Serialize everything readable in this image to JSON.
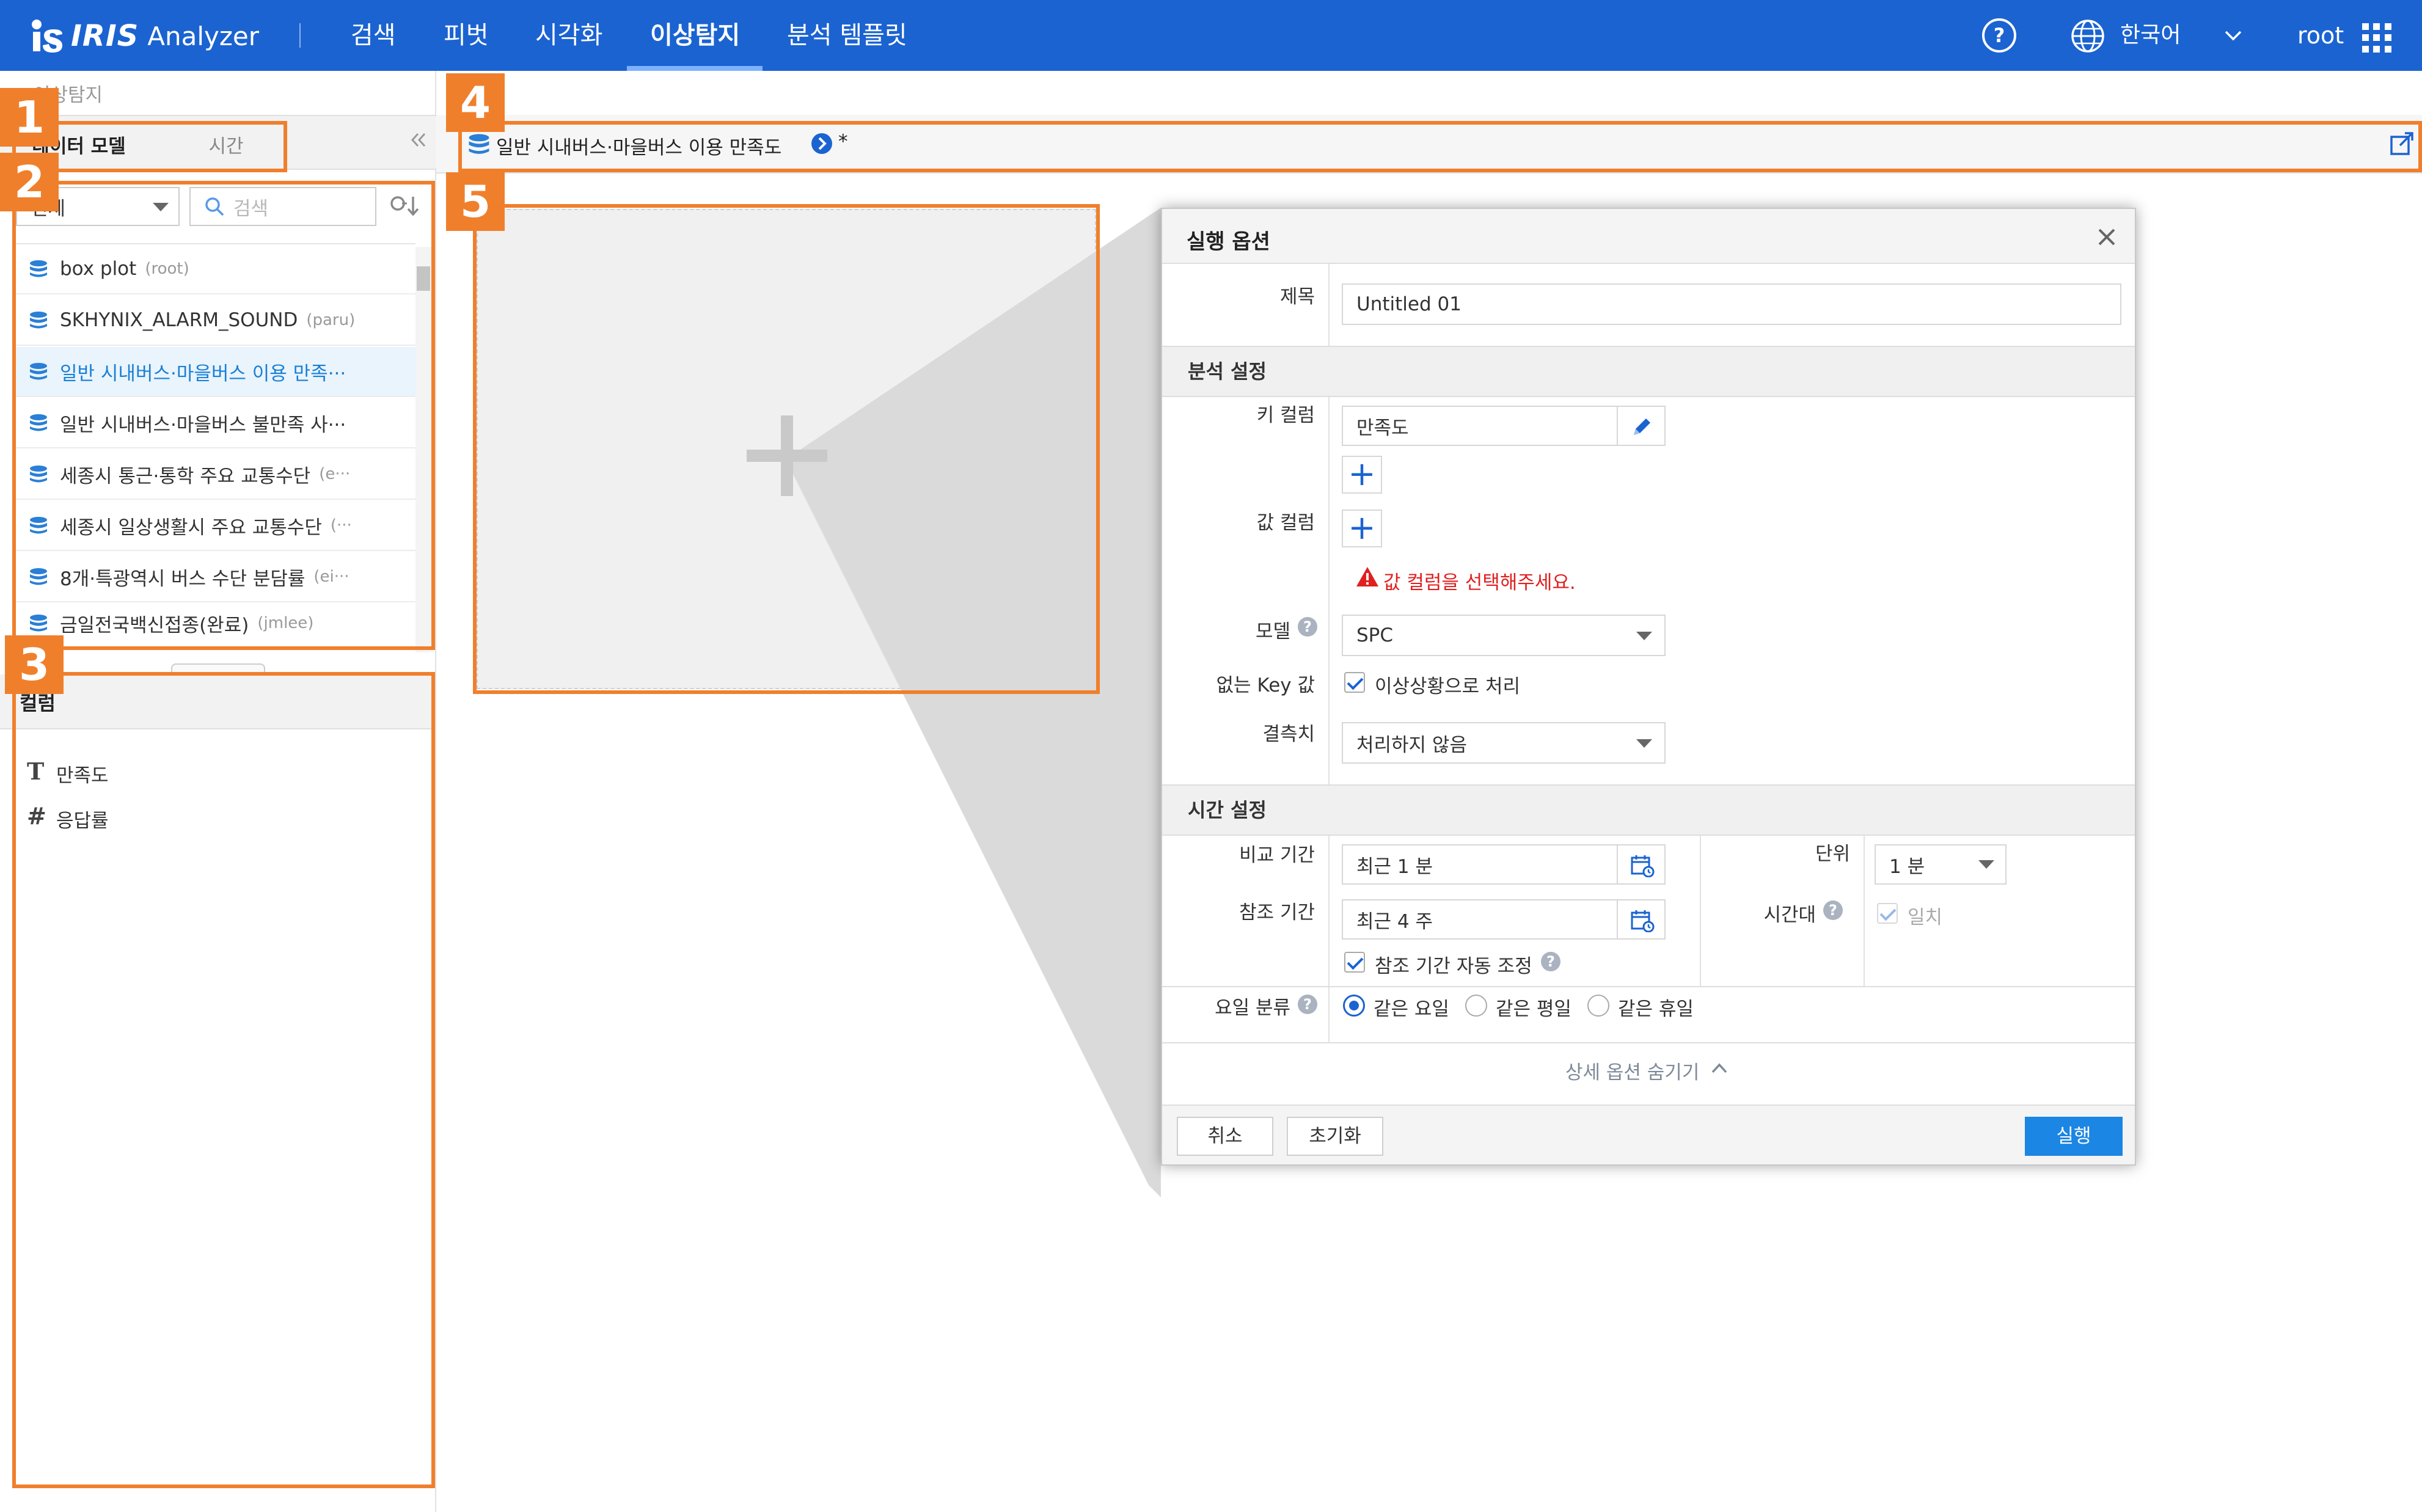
{
  "header": {
    "brand_logo": "IRIS",
    "brand_sub": "Analyzer",
    "nav": [
      "검색",
      "피벗",
      "시각화",
      "이상탐지",
      "분석 템플릿"
    ],
    "active_nav": "이상탐지",
    "language": "한국어",
    "user": "root"
  },
  "breadcrumb": "이상탐지",
  "left_panel": {
    "tabs": [
      "데이터 모델",
      "시간"
    ],
    "filter_value": "전체",
    "search_placeholder": "검색",
    "models": [
      {
        "name": "box plot",
        "owner": "(root)"
      },
      {
        "name": "SKHYNIX_ALARM_SOUND",
        "owner": "(paru)"
      },
      {
        "name": "일반 시내버스·마을버스 이용 만족···",
        "owner": ""
      },
      {
        "name": "일반 시내버스·마을버스 불만족 사···",
        "owner": ""
      },
      {
        "name": "세종시 통근·통학 주요 교통수단",
        "owner": "(e···"
      },
      {
        "name": "세종시 일상생활시 주요 교통수단",
        "owner": "(···"
      },
      {
        "name": "8개·특광역시 버스 수단 분담률",
        "owner": "(ei···"
      },
      {
        "name": "금일전국백신접종(완료)",
        "owner": "(jmlee)"
      }
    ],
    "column_header": "컬럼",
    "columns": [
      {
        "type_icon": "T",
        "name": "만족도"
      },
      {
        "type_icon": "#",
        "name": "응답률"
      }
    ]
  },
  "model_bar": {
    "title": "일반 시내버스·마을버스 이용 만족도",
    "modified_mark": "*"
  },
  "badges": [
    "1",
    "2",
    "3",
    "4",
    "5"
  ],
  "dialog": {
    "title": "실행 옵션",
    "title_label": "제목",
    "title_value": "Untitled 01",
    "analysis_section": "분석 설정",
    "key_column_label": "키 컬럼",
    "key_column_value": "만족도",
    "value_column_label": "값 컬럼",
    "value_column_error": "값 컬럼을 선택해주세요.",
    "model_label": "모델",
    "model_value": "SPC",
    "no_key_label": "없는 Key 값",
    "no_key_checkbox": "이상상황으로 처리",
    "missing_label": "결측치",
    "missing_value": "처리하지 않음",
    "time_section": "시간 설정",
    "compare_label": "비교 기간",
    "compare_value": "최근 1 분",
    "reference_label": "참조 기간",
    "reference_value": "최근 4 주",
    "auto_adjust_label": "참조 기간 자동 조정",
    "unit_label": "단위",
    "unit_value": "1 분",
    "timezone_label": "시간대",
    "timezone_checkbox": "일치",
    "weekday_label": "요일 분류",
    "weekday_options": [
      "같은 요일",
      "같은 평일",
      "같은 휴일"
    ],
    "weekday_selected": "같은 요일",
    "hide_options": "상세 옵션 숨기기",
    "cancel": "취소",
    "reset": "초기화",
    "run": "실행"
  },
  "colors": {
    "header_bg": "#1b63d1",
    "highlight": "#f07f2c",
    "error": "#e02020",
    "primary_button": "#1b86e3"
  }
}
